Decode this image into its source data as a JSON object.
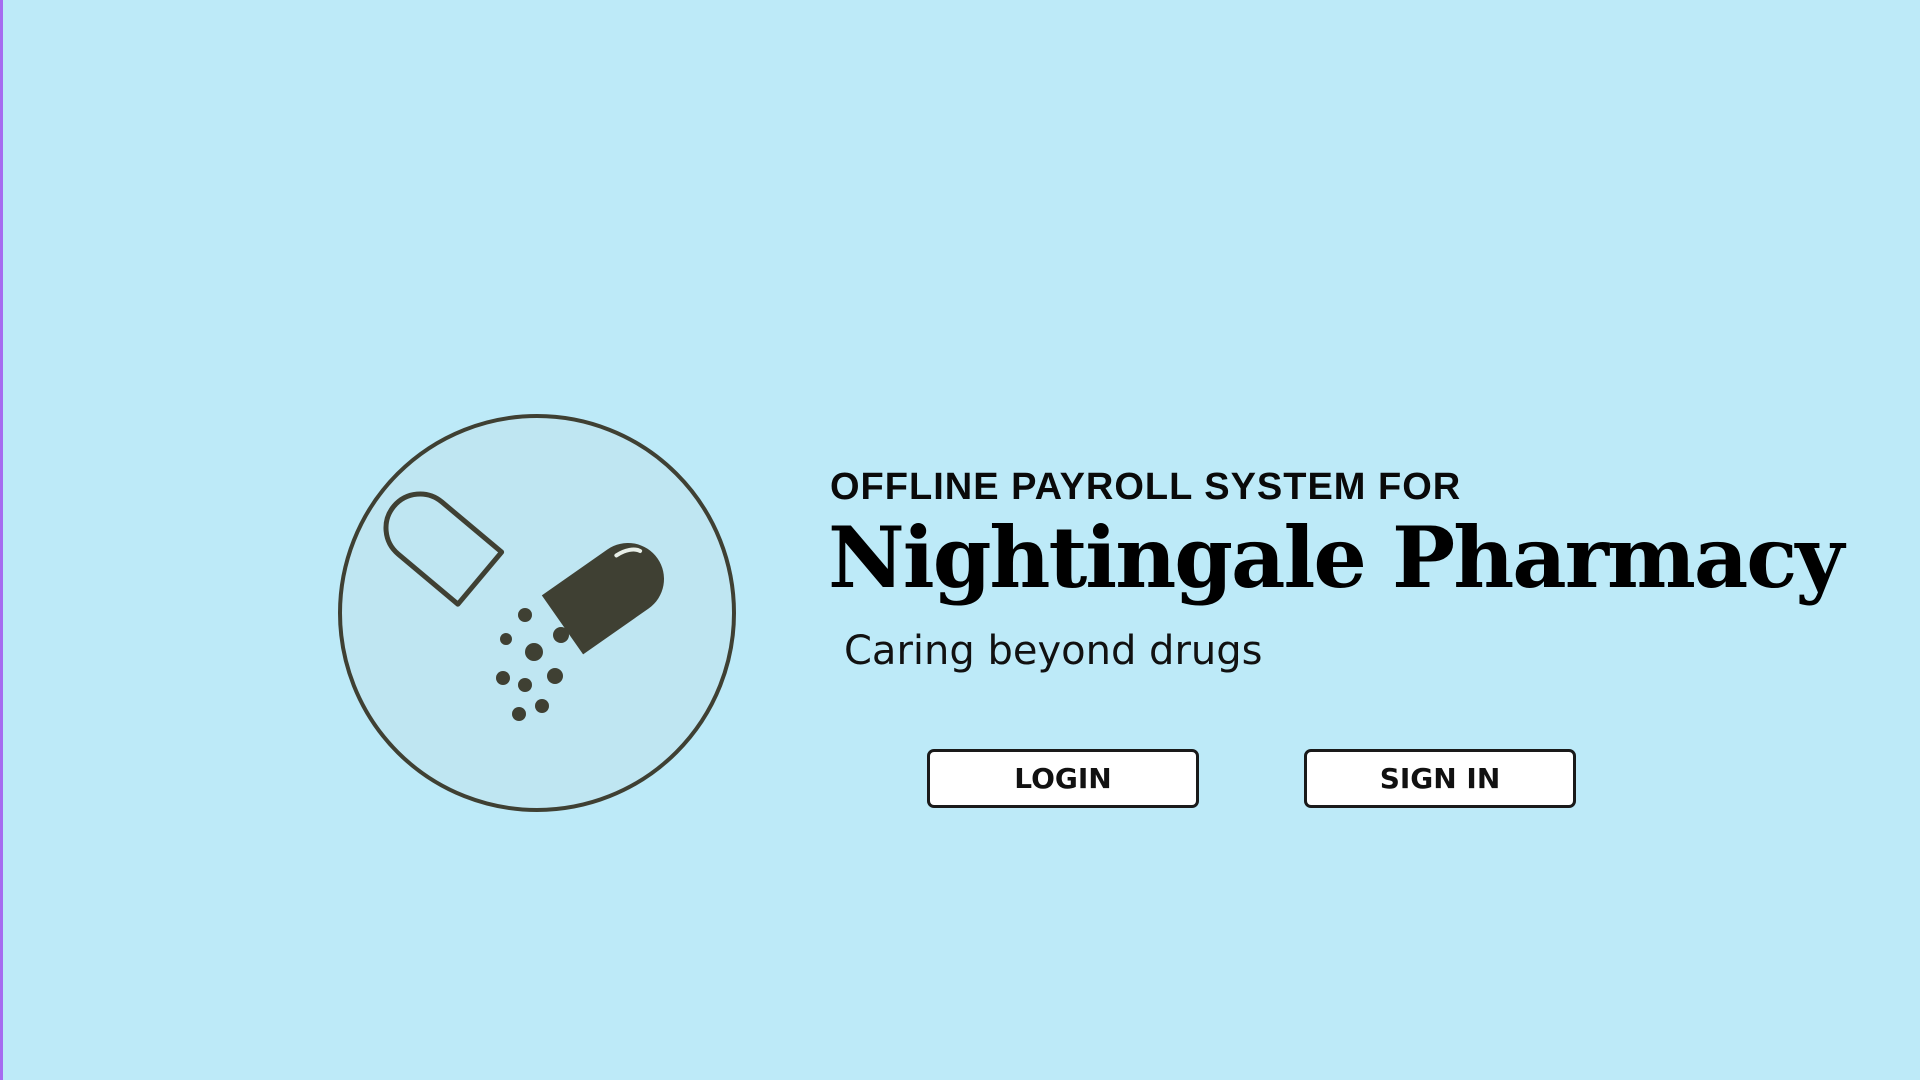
{
  "header": {
    "subtitle": "OFFLINE PAYROLL SYSTEM FOR",
    "title": "Nightingale Pharmacy",
    "tagline": "Caring beyond drugs"
  },
  "logo": {
    "icon": "capsule-icon"
  },
  "actions": {
    "login_label": "LOGIN",
    "signin_label": "SIGN IN"
  },
  "colors": {
    "background": "#bdeaf8",
    "logo_stroke": "#3f4033",
    "button_background": "#ffffff",
    "edge_accent": "#a66bf0"
  }
}
